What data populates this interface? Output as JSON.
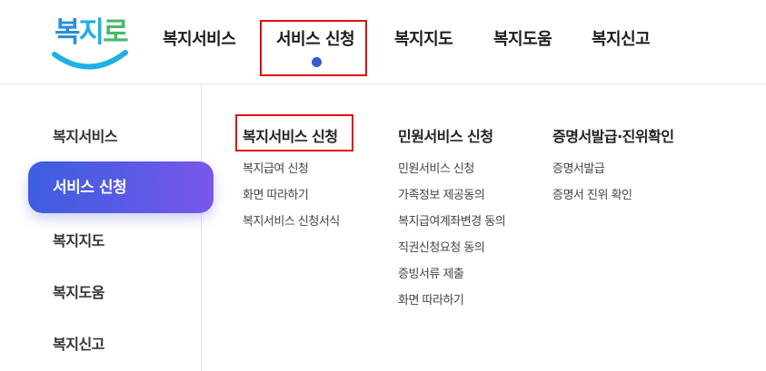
{
  "logo": {
    "text_1": "복",
    "text_2": "지",
    "text_3": "로"
  },
  "gnb": {
    "items": [
      "복지서비스",
      "서비스 신청",
      "복지지도",
      "복지도움",
      "복지신고"
    ],
    "active_index": 1
  },
  "sidebar": {
    "items": [
      "복지서비스",
      "서비스 신청",
      "복지지도",
      "복지도움",
      "복지신고"
    ],
    "active_index": 1
  },
  "columns": [
    {
      "title": "복지서비스 신청",
      "links": [
        "복지급여 신청",
        "화면 따라하기",
        "복지서비스 신청서식"
      ]
    },
    {
      "title": "민원서비스 신청",
      "links": [
        "민원서비스 신청",
        "가족정보 제공동의",
        "복지급여계좌변경 동의",
        "직권신청요청 동의",
        "증빙서류 제출",
        "화면 따라하기"
      ]
    },
    {
      "title": "증명서발급·진위확인",
      "links": [
        "증명서발급",
        "증명서 진위 확인"
      ]
    }
  ],
  "colors": {
    "accent": "#3e5de0",
    "highlight_border": "#e01010",
    "logo_blue": "#2b8fd6",
    "logo_smile": "#1fb0e3"
  }
}
